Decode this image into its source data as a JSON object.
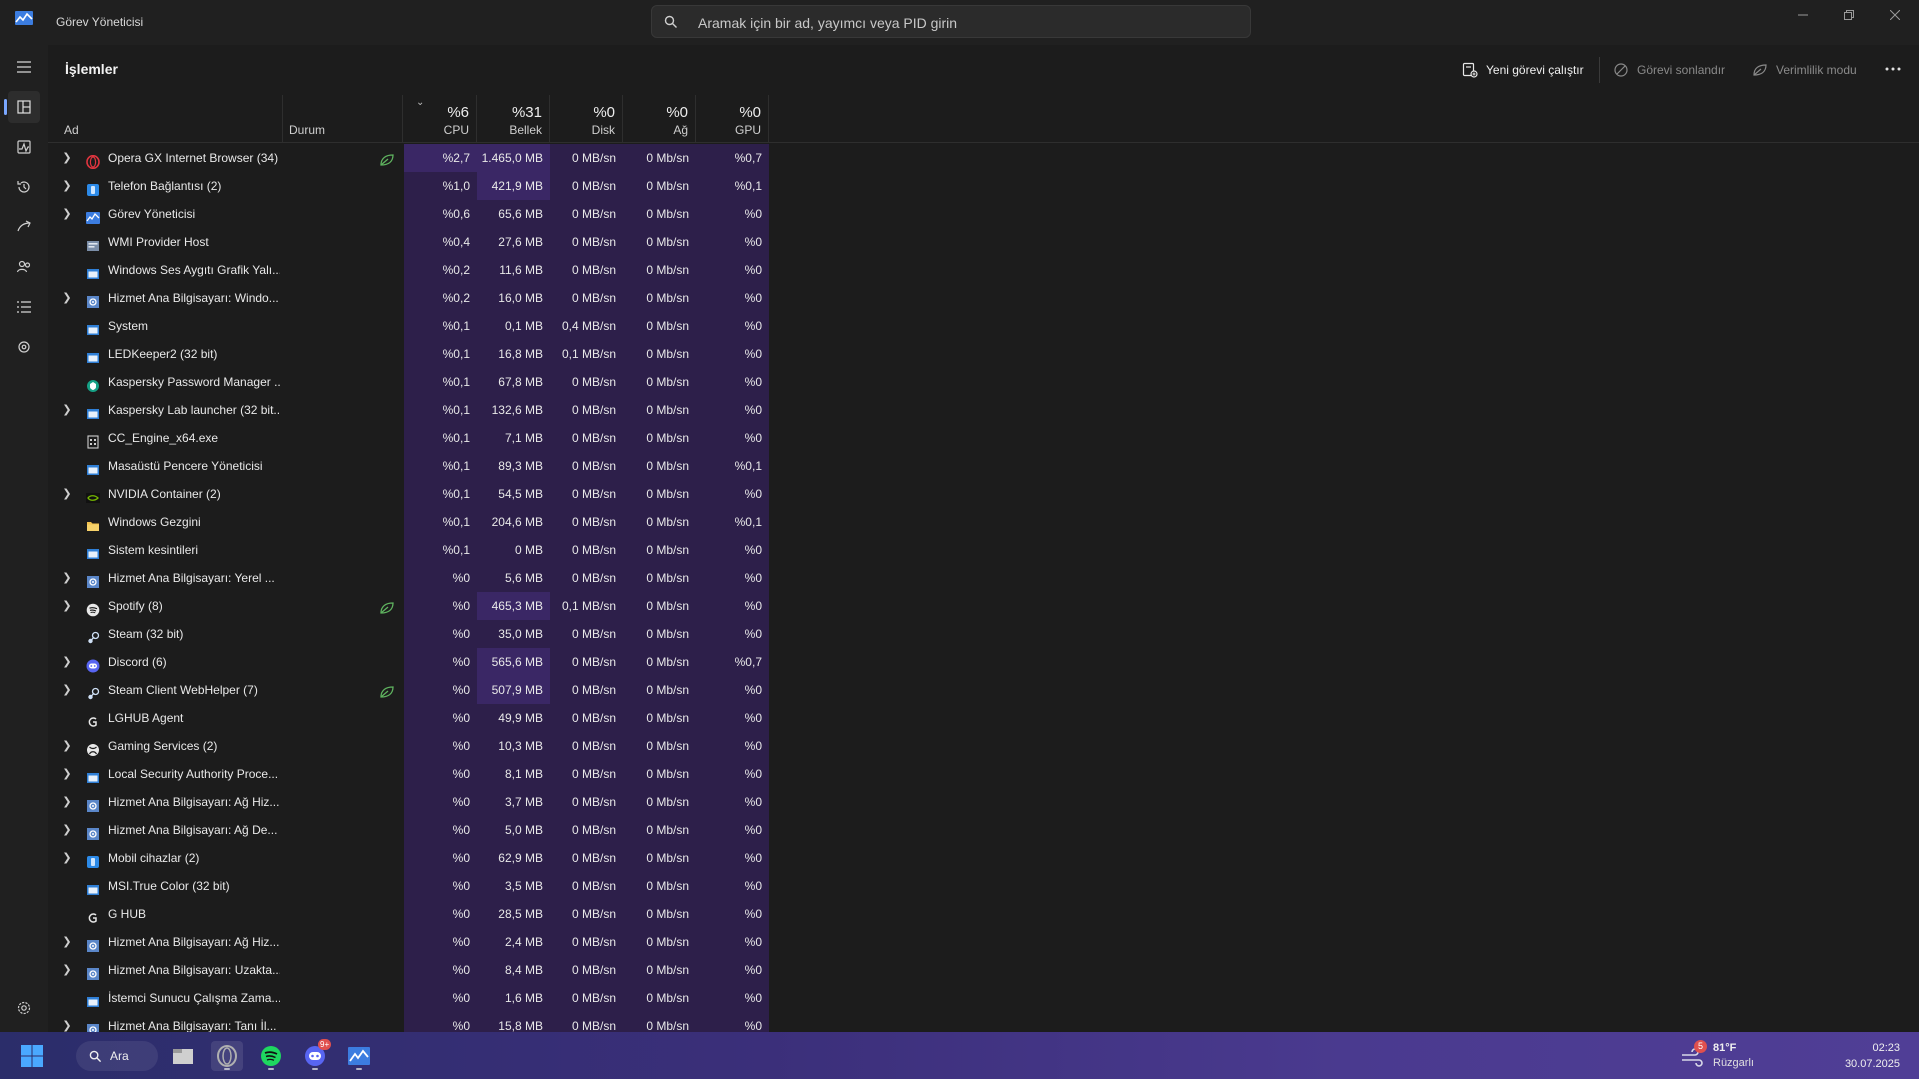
{
  "window": {
    "title": "Görev Yöneticisi"
  },
  "search": {
    "placeholder": "Aramak için bir ad, yayımcı veya PID girin"
  },
  "page": {
    "title": "İşlemler"
  },
  "commands": {
    "run_new_task": "Yeni görevi çalıştır",
    "end_task": "Görevi sonlandır",
    "efficiency_mode": "Verimlilik modu"
  },
  "columns": {
    "name": "Ad",
    "status": "Durum",
    "cpu": {
      "label": "CPU",
      "percent": "%6"
    },
    "memory": {
      "label": "Bellek",
      "percent": "%31"
    },
    "disk": {
      "label": "Disk",
      "percent": "%0"
    },
    "network": {
      "label": "Ağ",
      "percent": "%0"
    },
    "gpu": {
      "label": "GPU",
      "percent": "%0"
    }
  },
  "colors": {
    "accent": "#7aa7ff",
    "heat_low": "#2d1f4a",
    "heat_medium": "#3a2765",
    "efficiency_leaf": "#5fb35f"
  },
  "processes": [
    {
      "name": "Opera GX Internet Browser (34)",
      "expandable": true,
      "icon": "opera-gx-icon",
      "eco": true,
      "cpu": "%2,7",
      "mem": "1.465,0 MB",
      "disk": "0 MB/sn",
      "net": "0 Mb/sn",
      "gpu": "%0,7",
      "mem_heat": "med",
      "cpu_heat": "med"
    },
    {
      "name": "Telefon Bağlantısı (2)",
      "expandable": true,
      "icon": "phone-link-icon",
      "eco": false,
      "cpu": "%1,0",
      "mem": "421,9 MB",
      "disk": "0 MB/sn",
      "net": "0 Mb/sn",
      "gpu": "%0,1",
      "mem_heat": "med"
    },
    {
      "name": "Görev Yöneticisi",
      "expandable": true,
      "icon": "task-manager-icon",
      "eco": false,
      "cpu": "%0,6",
      "mem": "65,6 MB",
      "disk": "0 MB/sn",
      "net": "0 Mb/sn",
      "gpu": "%0"
    },
    {
      "name": "WMI Provider Host",
      "expandable": false,
      "icon": "wmi-icon",
      "eco": false,
      "cpu": "%0,4",
      "mem": "27,6 MB",
      "disk": "0 MB/sn",
      "net": "0 Mb/sn",
      "gpu": "%0"
    },
    {
      "name": "Windows Ses Aygıtı Grafik Yalı...",
      "expandable": false,
      "icon": "window-app-icon",
      "eco": false,
      "cpu": "%0,2",
      "mem": "11,6 MB",
      "disk": "0 MB/sn",
      "net": "0 Mb/sn",
      "gpu": "%0"
    },
    {
      "name": "Hizmet Ana Bilgisayarı: Windo...",
      "expandable": true,
      "icon": "service-host-icon",
      "eco": false,
      "cpu": "%0,2",
      "mem": "16,0 MB",
      "disk": "0 MB/sn",
      "net": "0 Mb/sn",
      "gpu": "%0"
    },
    {
      "name": "System",
      "expandable": false,
      "icon": "window-app-icon",
      "eco": false,
      "cpu": "%0,1",
      "mem": "0,1 MB",
      "disk": "0,4 MB/sn",
      "net": "0 Mb/sn",
      "gpu": "%0"
    },
    {
      "name": "LEDKeeper2 (32 bit)",
      "expandable": false,
      "icon": "window-app-icon",
      "eco": false,
      "cpu": "%0,1",
      "mem": "16,8 MB",
      "disk": "0,1 MB/sn",
      "net": "0 Mb/sn",
      "gpu": "%0"
    },
    {
      "name": "Kaspersky Password Manager ...",
      "expandable": false,
      "icon": "kaspersky-icon",
      "eco": false,
      "cpu": "%0,1",
      "mem": "67,8 MB",
      "disk": "0 MB/sn",
      "net": "0 Mb/sn",
      "gpu": "%0"
    },
    {
      "name": "Kaspersky Lab launcher (32 bit...",
      "expandable": true,
      "icon": "window-app-icon",
      "eco": false,
      "cpu": "%0,1",
      "mem": "132,6 MB",
      "disk": "0 MB/sn",
      "net": "0 Mb/sn",
      "gpu": "%0"
    },
    {
      "name": "CC_Engine_x64.exe",
      "expandable": false,
      "icon": "exe-icon",
      "eco": false,
      "cpu": "%0,1",
      "mem": "7,1 MB",
      "disk": "0 MB/sn",
      "net": "0 Mb/sn",
      "gpu": "%0"
    },
    {
      "name": "Masaüstü Pencere Yöneticisi",
      "expandable": false,
      "icon": "window-app-icon",
      "eco": false,
      "cpu": "%0,1",
      "mem": "89,3 MB",
      "disk": "0 MB/sn",
      "net": "0 Mb/sn",
      "gpu": "%0,1"
    },
    {
      "name": "NVIDIA Container (2)",
      "expandable": true,
      "icon": "nvidia-icon",
      "eco": false,
      "cpu": "%0,1",
      "mem": "54,5 MB",
      "disk": "0 MB/sn",
      "net": "0 Mb/sn",
      "gpu": "%0"
    },
    {
      "name": "Windows Gezgini",
      "expandable": false,
      "icon": "folder-icon",
      "eco": false,
      "cpu": "%0,1",
      "mem": "204,6 MB",
      "disk": "0 MB/sn",
      "net": "0 Mb/sn",
      "gpu": "%0,1"
    },
    {
      "name": "Sistem kesintileri",
      "expandable": false,
      "icon": "window-app-icon",
      "eco": false,
      "cpu": "%0,1",
      "mem": "0 MB",
      "disk": "0 MB/sn",
      "net": "0 Mb/sn",
      "gpu": "%0"
    },
    {
      "name": "Hizmet Ana Bilgisayarı: Yerel ...",
      "expandable": true,
      "icon": "service-host-icon",
      "eco": false,
      "cpu": "%0",
      "mem": "5,6 MB",
      "disk": "0 MB/sn",
      "net": "0 Mb/sn",
      "gpu": "%0"
    },
    {
      "name": "Spotify (8)",
      "expandable": true,
      "icon": "spotify-icon",
      "eco": true,
      "cpu": "%0",
      "mem": "465,3 MB",
      "disk": "0,1 MB/sn",
      "net": "0 Mb/sn",
      "gpu": "%0",
      "mem_heat": "med"
    },
    {
      "name": "Steam (32 bit)",
      "expandable": false,
      "icon": "steam-icon",
      "eco": false,
      "cpu": "%0",
      "mem": "35,0 MB",
      "disk": "0 MB/sn",
      "net": "0 Mb/sn",
      "gpu": "%0"
    },
    {
      "name": "Discord (6)",
      "expandable": true,
      "icon": "discord-icon",
      "eco": false,
      "cpu": "%0",
      "mem": "565,6 MB",
      "disk": "0 MB/sn",
      "net": "0 Mb/sn",
      "gpu": "%0,7",
      "mem_heat": "med"
    },
    {
      "name": "Steam Client WebHelper (7)",
      "expandable": true,
      "icon": "steam-icon",
      "eco": true,
      "cpu": "%0",
      "mem": "507,9 MB",
      "disk": "0 MB/sn",
      "net": "0 Mb/sn",
      "gpu": "%0",
      "mem_heat": "med"
    },
    {
      "name": "LGHUB Agent",
      "expandable": false,
      "icon": "logitech-icon",
      "eco": false,
      "cpu": "%0",
      "mem": "49,9 MB",
      "disk": "0 MB/sn",
      "net": "0 Mb/sn",
      "gpu": "%0"
    },
    {
      "name": "Gaming Services (2)",
      "expandable": true,
      "icon": "xbox-icon",
      "eco": false,
      "cpu": "%0",
      "mem": "10,3 MB",
      "disk": "0 MB/sn",
      "net": "0 Mb/sn",
      "gpu": "%0"
    },
    {
      "name": "Local Security Authority Proce...",
      "expandable": true,
      "icon": "window-app-icon",
      "eco": false,
      "cpu": "%0",
      "mem": "8,1 MB",
      "disk": "0 MB/sn",
      "net": "0 Mb/sn",
      "gpu": "%0"
    },
    {
      "name": "Hizmet Ana Bilgisayarı: Ağ Hiz...",
      "expandable": true,
      "icon": "service-host-icon",
      "eco": false,
      "cpu": "%0",
      "mem": "3,7 MB",
      "disk": "0 MB/sn",
      "net": "0 Mb/sn",
      "gpu": "%0"
    },
    {
      "name": "Hizmet Ana Bilgisayarı: Ağ De...",
      "expandable": true,
      "icon": "service-host-icon",
      "eco": false,
      "cpu": "%0",
      "mem": "5,0 MB",
      "disk": "0 MB/sn",
      "net": "0 Mb/sn",
      "gpu": "%0"
    },
    {
      "name": "Mobil cihazlar (2)",
      "expandable": true,
      "icon": "phone-link-icon",
      "eco": false,
      "cpu": "%0",
      "mem": "62,9 MB",
      "disk": "0 MB/sn",
      "net": "0 Mb/sn",
      "gpu": "%0"
    },
    {
      "name": "MSI.True Color (32 bit)",
      "expandable": false,
      "icon": "window-app-icon",
      "eco": false,
      "cpu": "%0",
      "mem": "3,5 MB",
      "disk": "0 MB/sn",
      "net": "0 Mb/sn",
      "gpu": "%0"
    },
    {
      "name": "G HUB",
      "expandable": false,
      "icon": "logitech-icon",
      "eco": false,
      "cpu": "%0",
      "mem": "28,5 MB",
      "disk": "0 MB/sn",
      "net": "0 Mb/sn",
      "gpu": "%0"
    },
    {
      "name": "Hizmet Ana Bilgisayarı: Ağ Hiz...",
      "expandable": true,
      "icon": "service-host-icon",
      "eco": false,
      "cpu": "%0",
      "mem": "2,4 MB",
      "disk": "0 MB/sn",
      "net": "0 Mb/sn",
      "gpu": "%0"
    },
    {
      "name": "Hizmet Ana Bilgisayarı: Uzakta...",
      "expandable": true,
      "icon": "service-host-icon",
      "eco": false,
      "cpu": "%0",
      "mem": "8,4 MB",
      "disk": "0 MB/sn",
      "net": "0 Mb/sn",
      "gpu": "%0"
    },
    {
      "name": "İstemci Sunucu Çalışma Zama...",
      "expandable": false,
      "icon": "window-app-icon",
      "eco": false,
      "cpu": "%0",
      "mem": "1,6 MB",
      "disk": "0 MB/sn",
      "net": "0 Mb/sn",
      "gpu": "%0"
    },
    {
      "name": "Hizmet Ana Bilgisayarı: Tanı İl...",
      "expandable": true,
      "icon": "service-host-icon",
      "eco": false,
      "cpu": "%0",
      "mem": "15,8 MB",
      "disk": "0 MB/sn",
      "net": "0 Mb/sn",
      "gpu": "%0"
    }
  ],
  "taskbar": {
    "search_label": "Ara",
    "weather": {
      "temp": "81°F",
      "condition": "Rüzgarlı",
      "badge": "5"
    },
    "discord_badge": "9+",
    "time": "02:23",
    "date": "30.07.2025"
  }
}
